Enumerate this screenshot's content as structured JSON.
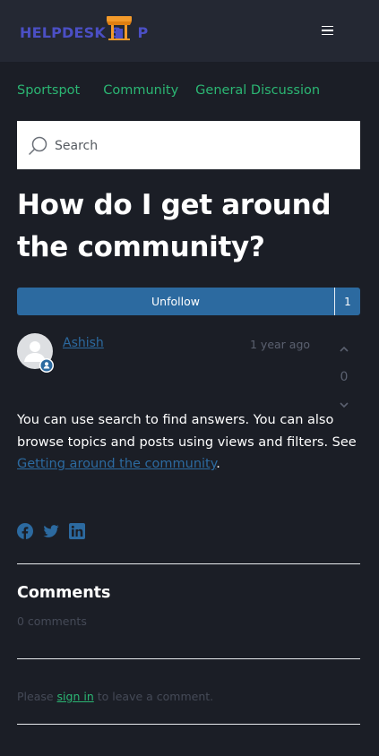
{
  "header": {
    "logo_text_1": "HELPDESK S",
    "logo_text_2": "P",
    "logo_alt": "HELPDESK SHOP",
    "menu_icon": "hamburger-menu-icon"
  },
  "breadcrumb": {
    "items": [
      {
        "label": "Sportspot"
      },
      {
        "label": "Community"
      },
      {
        "label": "General Discussion"
      }
    ]
  },
  "search": {
    "placeholder": "Search",
    "icon": "search-icon"
  },
  "post": {
    "title": "How do I get around the community?",
    "follow_label": "Unfollow",
    "follower_count": "1",
    "author": "Ashish",
    "time": "1 year ago",
    "vote_count": "0",
    "body_text": "You can use search to find answers. You can also browse topics and posts using views and filters. See ",
    "body_link": "Getting around the community",
    "body_end": "."
  },
  "share": {
    "icons": [
      "facebook-icon",
      "twitter-icon",
      "linkedin-icon"
    ]
  },
  "comments": {
    "heading": "Comments",
    "count_text": "0 comments",
    "prompt_before": "Please ",
    "prompt_link": "sign in",
    "prompt_after": " to leave a comment."
  },
  "colors": {
    "background": "#1b1e26",
    "header": "#242833",
    "accent_green": "#2bb673",
    "accent_blue": "#2c6aa0",
    "logo_blue": "#4b4fc4",
    "logo_orange": "#f39a2b"
  }
}
